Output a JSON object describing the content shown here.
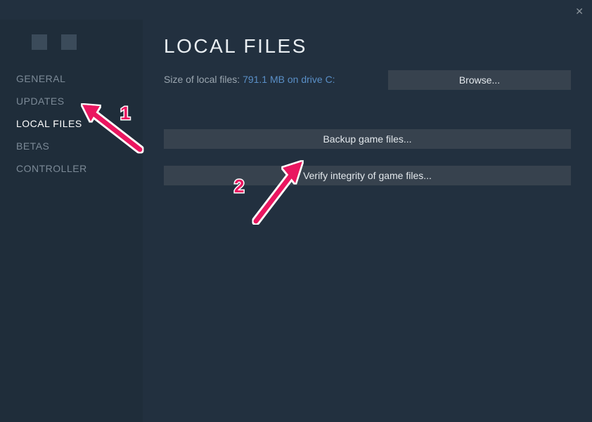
{
  "sidebar": {
    "items": [
      {
        "label": "GENERAL",
        "active": false
      },
      {
        "label": "UPDATES",
        "active": false
      },
      {
        "label": "LOCAL FILES",
        "active": true
      },
      {
        "label": "BETAS",
        "active": false
      },
      {
        "label": "CONTROLLER",
        "active": false
      }
    ]
  },
  "main": {
    "heading": "LOCAL FILES",
    "size_label": "Size of local files: ",
    "size_value": "791.1 MB on drive C:",
    "browse_label": "Browse...",
    "backup_label": "Backup game files...",
    "verify_label": "Verify integrity of game files..."
  },
  "annotations": {
    "step1": "1",
    "step2": "2"
  }
}
